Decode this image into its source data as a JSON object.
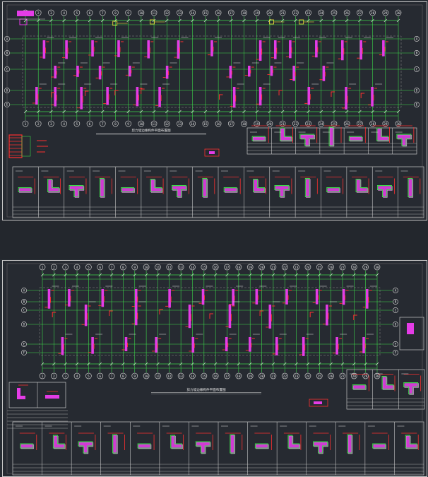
{
  "drawing": {
    "background": "#262a31",
    "colors": {
      "grid": "#3dd94a",
      "column": "#e43ce6",
      "rebar": "#ff3030",
      "frame": "#c8c8c8",
      "text": "#e6e6e6",
      "highlight": "#f2e03a"
    },
    "sheets": [
      {
        "id": "top",
        "grid_labels": [
          "1",
          "2",
          "3",
          "4",
          "5",
          "6",
          "7",
          "8",
          "9",
          "10",
          "11",
          "12",
          "13",
          "14",
          "15",
          "16",
          "17",
          "18",
          "19",
          "20",
          "21",
          "22",
          "23",
          "24",
          "25",
          "26",
          "27",
          "28",
          "29",
          "30"
        ],
        "row_labels": [
          "A",
          "B",
          "C",
          "D",
          "E",
          "F"
        ],
        "title": "剪力墙边缘构件平面布置图",
        "detail_count_top": 7,
        "detail_count_bottom": 16
      },
      {
        "id": "bottom",
        "grid_labels": [
          "1",
          "2",
          "3",
          "4",
          "5",
          "6",
          "7",
          "8",
          "9",
          "10",
          "11",
          "12",
          "13",
          "14",
          "15",
          "16",
          "17",
          "18",
          "19",
          "20",
          "21",
          "22",
          "23",
          "24",
          "25",
          "26",
          "27",
          "28",
          "29",
          "30"
        ],
        "row_labels": [
          "A",
          "B",
          "C",
          "D",
          "E",
          "F"
        ],
        "title": "剪力墙边缘构件平面布置图",
        "detail_count_top": 3,
        "detail_count_bottom": 14
      }
    ]
  }
}
